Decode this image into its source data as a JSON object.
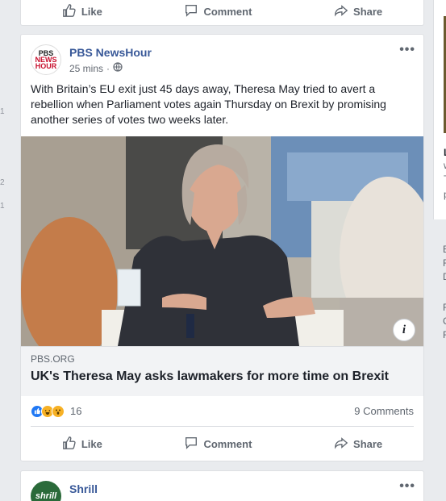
{
  "gutter": {
    "n1": "1",
    "n2": "2",
    "n3": "1"
  },
  "top_actions": {
    "like": "Like",
    "comment": "Comment",
    "share": "Share"
  },
  "post": {
    "author": "PBS NewsHour",
    "avatar_line1": "PBS",
    "avatar_line2": "NEWS",
    "avatar_line3": "HOUR",
    "time": "25 mins",
    "privacy_icon": "globe-icon",
    "text": "With Britain’s EU exit just 45 days away, Theresa May tried to avert a rebellion when Parliament votes again Thursday on Brexit by promising another series of votes two weeks later.",
    "link": {
      "domain": "PBS.ORG",
      "title": "UK's Theresa May asks lawmakers for more time on Brexit"
    },
    "info_label": "i",
    "reactions": {
      "count": "16",
      "comments": "9 Comments"
    },
    "actions": {
      "like": "Like",
      "comment": "Comment",
      "share": "Share"
    }
  },
  "next_post": {
    "author": "Shrill",
    "avatar": "shrill"
  },
  "right_column": {
    "letters": [
      "L",
      "w",
      "T",
      "p",
      "E",
      "F",
      "D",
      "F",
      "C",
      "F"
    ]
  },
  "colors": {
    "link_blue": "#385898",
    "like_blue": "#2078f4",
    "bg": "#e9ebee"
  }
}
